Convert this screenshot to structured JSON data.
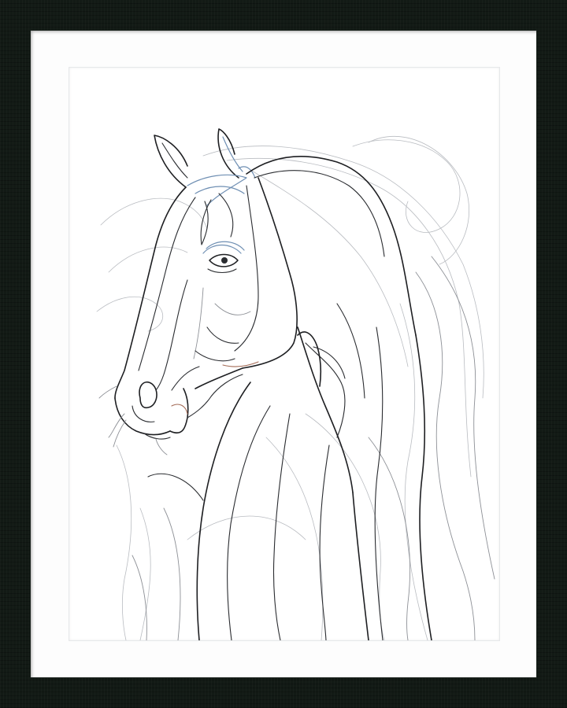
{
  "artwork": {
    "subject_icon": "horse-head-line-drawing",
    "colors": {
      "frame": "#121a15",
      "mat": "#fdfdfd",
      "ink": "#1e1f22",
      "accent_blue": "#6f8fb3",
      "accent_rust": "#a36a55"
    }
  }
}
